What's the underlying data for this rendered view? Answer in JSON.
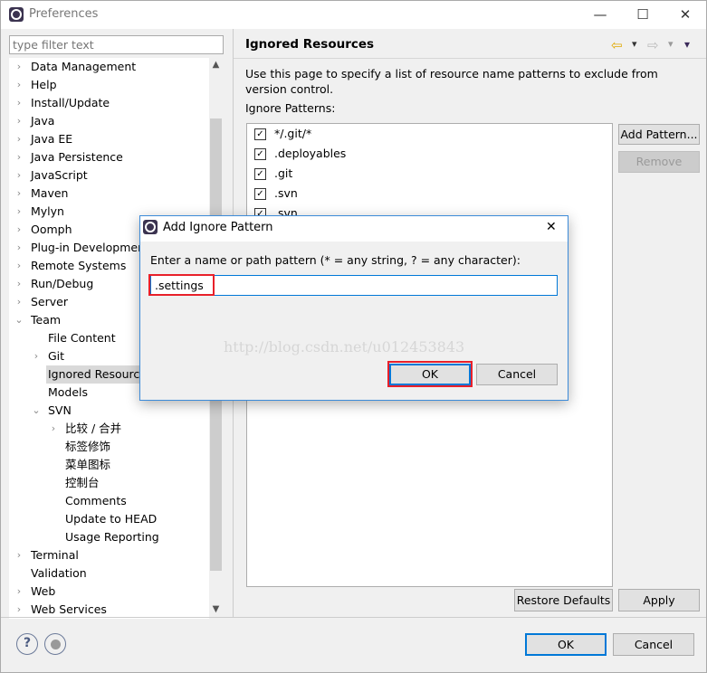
{
  "window": {
    "title": "Preferences",
    "minimize": "—",
    "maximize": "☐",
    "close": "✕"
  },
  "filter": {
    "placeholder": "type filter text"
  },
  "tree": [
    {
      "label": "Data Management",
      "level": 0,
      "arrow": "›"
    },
    {
      "label": "Help",
      "level": 0,
      "arrow": "›"
    },
    {
      "label": "Install/Update",
      "level": 0,
      "arrow": "›"
    },
    {
      "label": "Java",
      "level": 0,
      "arrow": "›"
    },
    {
      "label": "Java EE",
      "level": 0,
      "arrow": "›"
    },
    {
      "label": "Java Persistence",
      "level": 0,
      "arrow": "›"
    },
    {
      "label": "JavaScript",
      "level": 0,
      "arrow": "›"
    },
    {
      "label": "Maven",
      "level": 0,
      "arrow": "›"
    },
    {
      "label": "Mylyn",
      "level": 0,
      "arrow": "›"
    },
    {
      "label": "Oomph",
      "level": 0,
      "arrow": "›"
    },
    {
      "label": "Plug-in Development",
      "level": 0,
      "arrow": "›"
    },
    {
      "label": "Remote Systems",
      "level": 0,
      "arrow": "›"
    },
    {
      "label": "Run/Debug",
      "level": 0,
      "arrow": "›"
    },
    {
      "label": "Server",
      "level": 0,
      "arrow": "›"
    },
    {
      "label": "Team",
      "level": 0,
      "arrow": "⌄"
    },
    {
      "label": "File Content",
      "level": 1,
      "arrow": ""
    },
    {
      "label": "Git",
      "level": 1,
      "arrow": "›"
    },
    {
      "label": "Ignored Resources",
      "level": 1,
      "arrow": "",
      "selected": true
    },
    {
      "label": "Models",
      "level": 1,
      "arrow": ""
    },
    {
      "label": "SVN",
      "level": 1,
      "arrow": "⌄"
    },
    {
      "label": "比较 / 合并",
      "level": 2,
      "arrow": "›"
    },
    {
      "label": "标签修饰",
      "level": 2,
      "arrow": ""
    },
    {
      "label": "菜单图标",
      "level": 2,
      "arrow": ""
    },
    {
      "label": "控制台",
      "level": 2,
      "arrow": ""
    },
    {
      "label": "Comments",
      "level": 2,
      "arrow": ""
    },
    {
      "label": "Update to HEAD",
      "level": 2,
      "arrow": ""
    },
    {
      "label": "Usage Reporting",
      "level": 2,
      "arrow": ""
    },
    {
      "label": "Terminal",
      "level": 0,
      "arrow": "›"
    },
    {
      "label": "Validation",
      "level": 0,
      "arrow": ""
    },
    {
      "label": "Web",
      "level": 0,
      "arrow": "›"
    },
    {
      "label": "Web Services",
      "level": 0,
      "arrow": "›"
    }
  ],
  "page": {
    "title": "Ignored Resources",
    "description": "Use this page to specify a list of resource name patterns to exclude from version control.",
    "patterns_label": "Ignore Patterns:",
    "patterns": [
      {
        "text": "*/.git/*",
        "checked": true
      },
      {
        "text": ".deployables",
        "checked": true
      },
      {
        "text": ".git",
        "checked": true
      },
      {
        "text": ".svn",
        "checked": true
      },
      {
        "text": ".svn",
        "checked": true
      }
    ],
    "add_pattern": "Add Pattern...",
    "remove": "Remove",
    "restore_defaults": "Restore Defaults",
    "apply": "Apply"
  },
  "nav": {
    "back": "⇦",
    "forward": "⇨",
    "dropdown": "▾"
  },
  "footer": {
    "ok": "OK",
    "cancel": "Cancel",
    "help": "?"
  },
  "dialog": {
    "title": "Add Ignore Pattern",
    "close": "✕",
    "prompt": "Enter a name or path pattern (* = any string, ? = any character):",
    "value": ".settings",
    "ok": "OK",
    "cancel": "Cancel"
  },
  "colors": {
    "accent": "#0078d7",
    "highlight": "#e8202a"
  },
  "watermark": "http://blog.csdn.net/u012453843"
}
